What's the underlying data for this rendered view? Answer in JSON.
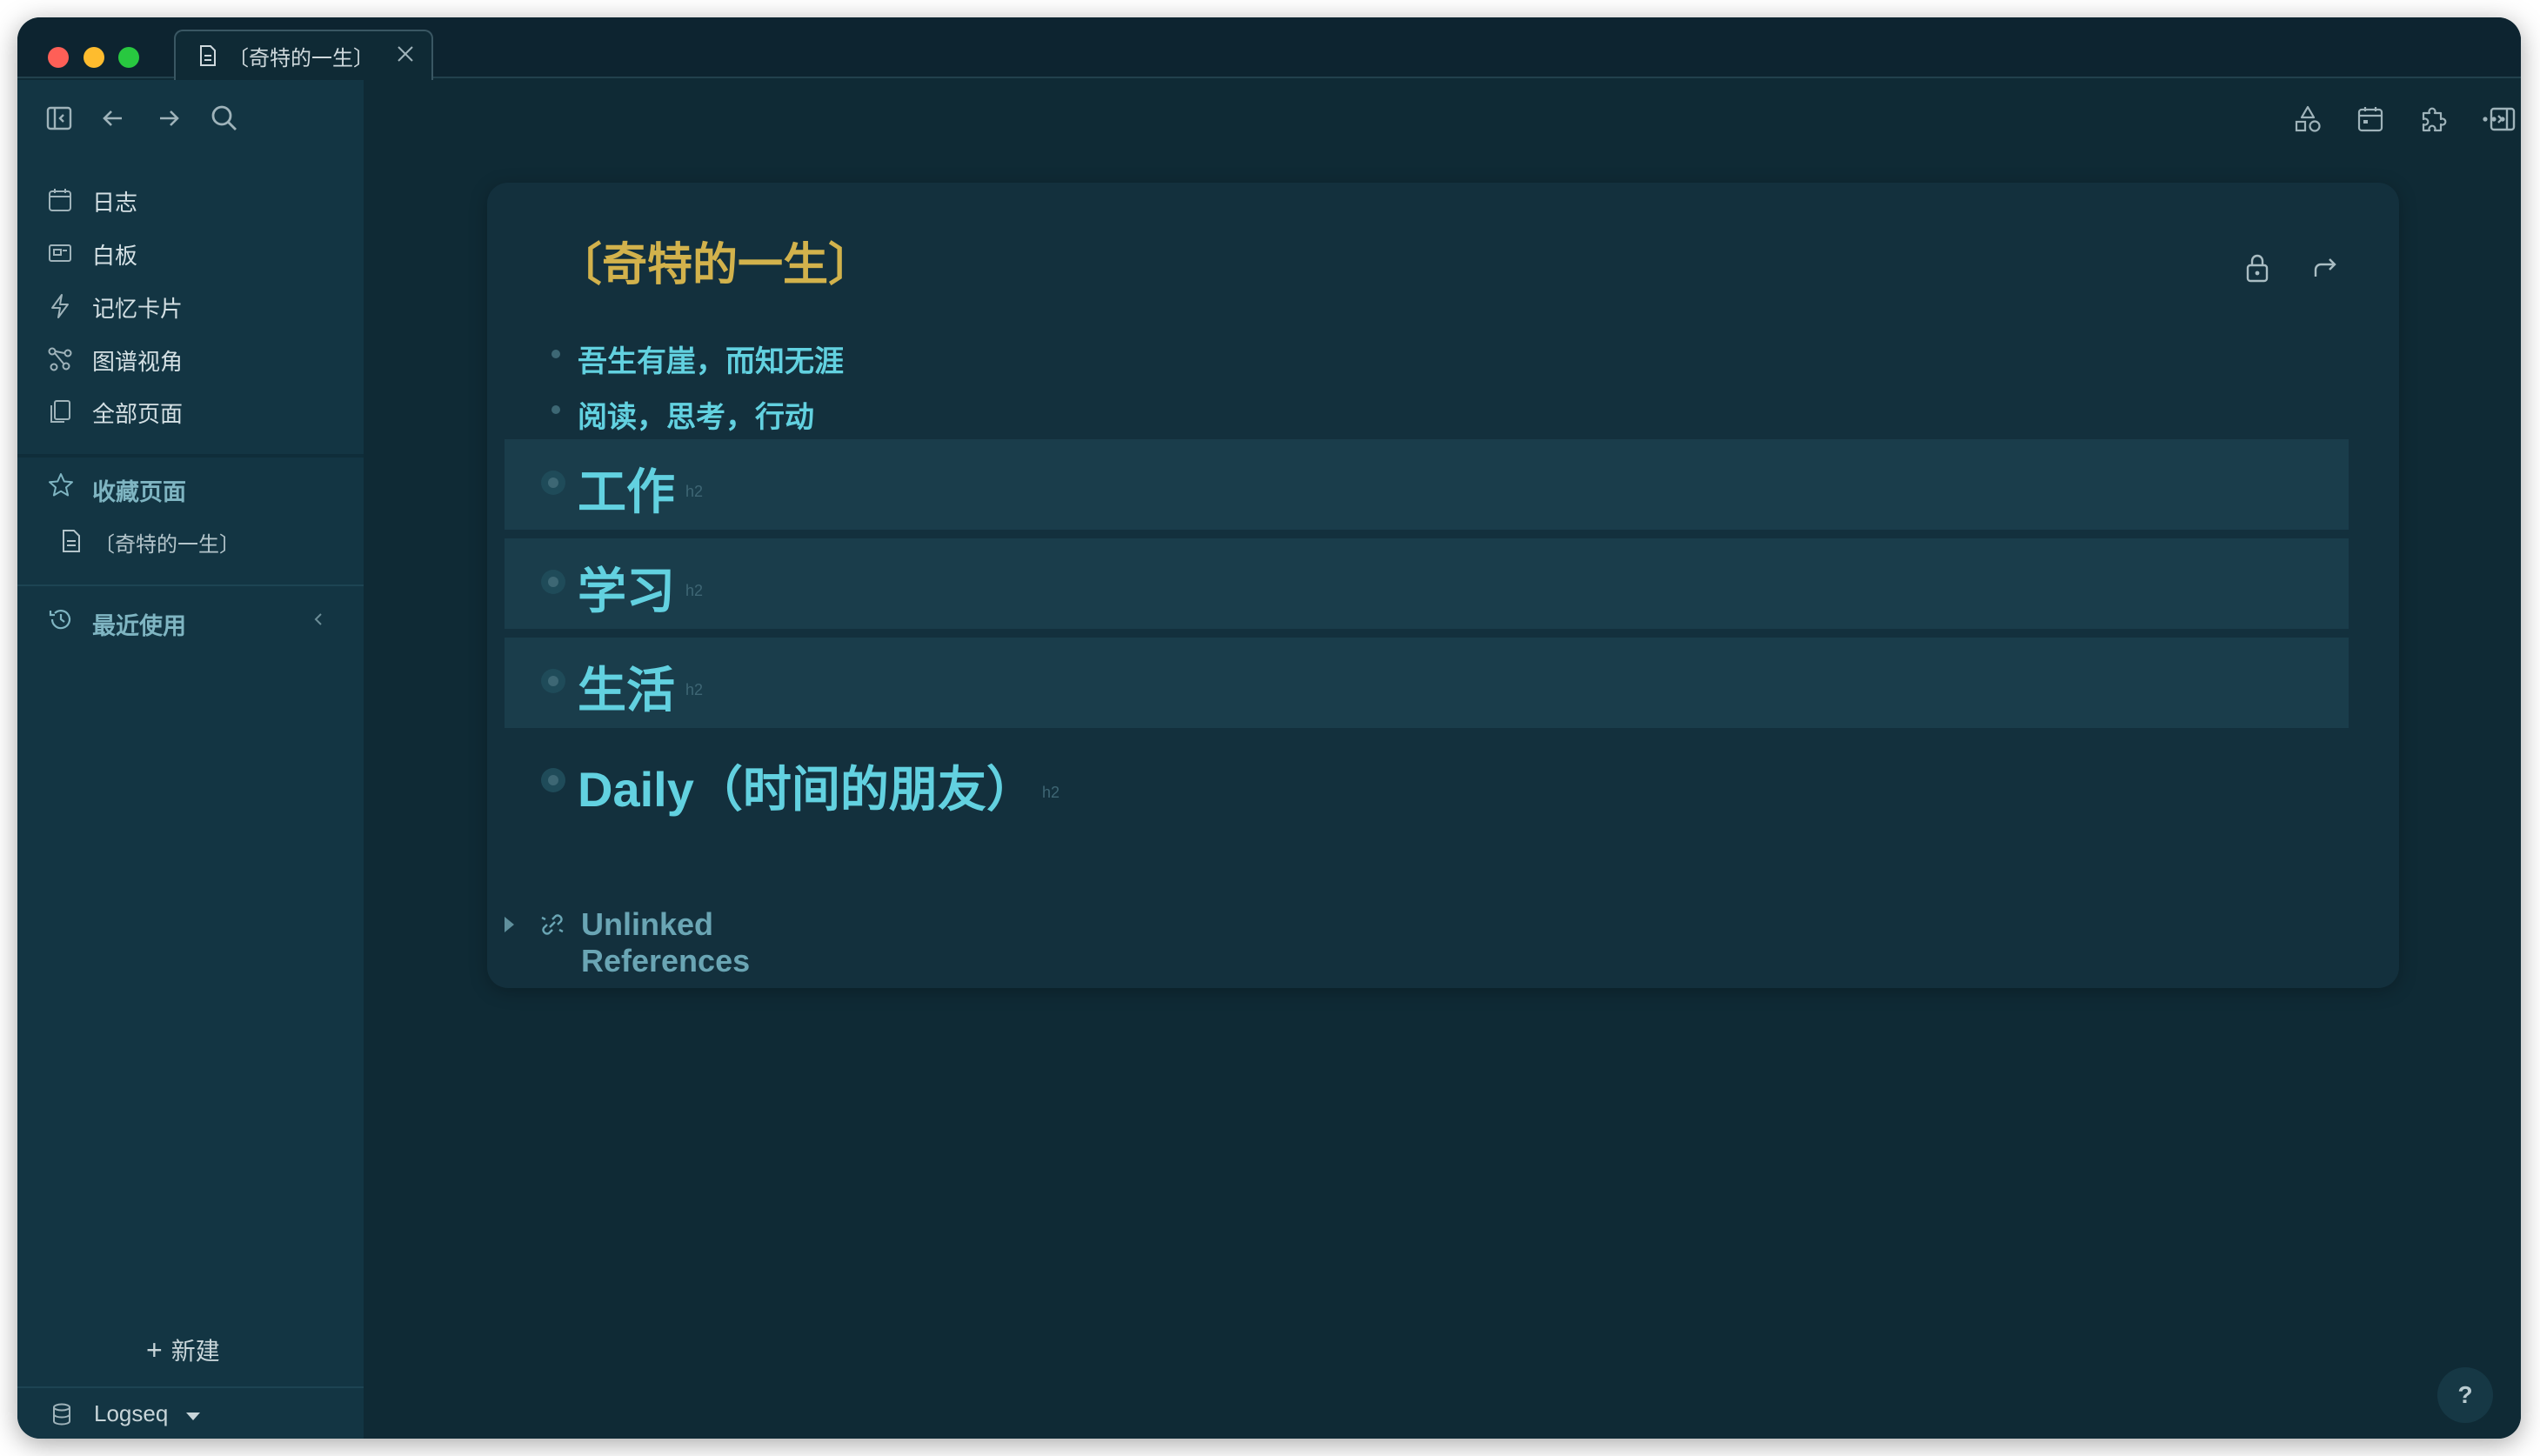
{
  "tab": {
    "title": "〔奇特的一生〕"
  },
  "sidebar": {
    "nav": [
      {
        "label": "日志",
        "icon": "calendar-icon"
      },
      {
        "label": "白板",
        "icon": "whiteboard-icon"
      },
      {
        "label": "记忆卡片",
        "icon": "flashcards-icon"
      },
      {
        "label": "图谱视角",
        "icon": "graph-icon"
      },
      {
        "label": "全部页面",
        "icon": "all-pages-icon"
      }
    ],
    "favorites": {
      "title": "收藏页面",
      "items": [
        "〔奇特的一生〕"
      ]
    },
    "recent": {
      "title": "最近使用"
    },
    "new_label": "新建",
    "graph_name": "Logseq"
  },
  "page": {
    "title": "〔奇特的一生〕",
    "blocks": [
      {
        "text": "吾生有崖，而知无涯"
      },
      {
        "text": "阅读，思考，行动"
      }
    ],
    "headings": [
      {
        "text": "工作",
        "tag": "h2"
      },
      {
        "text": "学习",
        "tag": "h2"
      },
      {
        "text": "生活",
        "tag": "h2"
      },
      {
        "text": "Daily（时间的朋友）",
        "tag": "h2"
      }
    ],
    "unlinked_references": "Unlinked References"
  },
  "help": "?",
  "colors": {
    "background": "#0f2a35",
    "sidebar": "#133543",
    "title": "#d2b24c",
    "text_accent": "#62d1e0"
  }
}
